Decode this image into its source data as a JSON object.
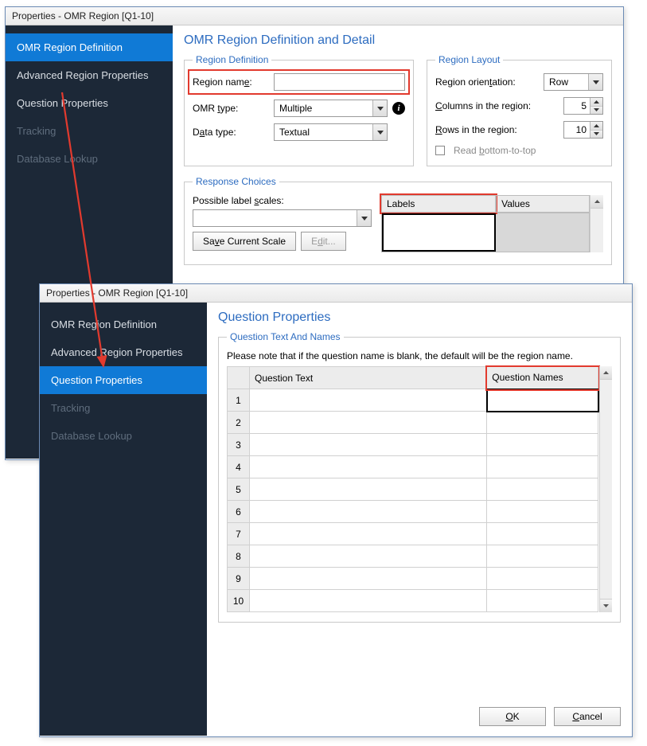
{
  "windows": {
    "title": "Properties - OMR Region [Q1-10]"
  },
  "sidebar": {
    "items": [
      {
        "label": "OMR Region Definition"
      },
      {
        "label": "Advanced Region Properties"
      },
      {
        "label": "Question Properties"
      },
      {
        "label": "Tracking"
      },
      {
        "label": "Database Lookup"
      }
    ]
  },
  "page1": {
    "title": "OMR Region Definition and Detail",
    "groupDef": {
      "legend": "Region Definition",
      "regionNameLabelPre": "Region nam",
      "regionNameLabelU": "e",
      "regionNameLabelPost": ":",
      "regionNameValue": "",
      "omrTypeLabelPre": "OMR ",
      "omrTypeLabelU": "t",
      "omrTypeLabelPost": "ype:",
      "omrTypeValue": "Multiple",
      "dataTypeLabelPre": "D",
      "dataTypeLabelU": "a",
      "dataTypeLabelPost": "ta type:",
      "dataTypeValue": "Textual"
    },
    "groupLayout": {
      "legend": "Region Layout",
      "orientationLabelPre": "Region orien",
      "orientationLabelU": "t",
      "orientationLabelPost": "ation:",
      "orientationValue": "Row",
      "colsLabelPre": "",
      "colsLabelU": "C",
      "colsLabelPost": "olumns in the region:",
      "colsValue": "5",
      "rowsLabelPre": "",
      "rowsLabelU": "R",
      "rowsLabelPost": "ows in the region:",
      "rowsValue": "10",
      "readLabelPre": "Read ",
      "readLabelU": "b",
      "readLabelPost": "ottom-to-top"
    },
    "groupResp": {
      "legend": "Response Choices",
      "possLabelPre": "Possible label ",
      "possLabelU": "s",
      "possLabelPost": "cales:",
      "saveBtnPre": "Sa",
      "saveBtnU": "v",
      "saveBtnPost": "e Current Scale",
      "editBtnPre": "E",
      "editBtnU": "d",
      "editBtnPost": "it...",
      "colLabels": "Labels",
      "colValues": "Values"
    }
  },
  "page2": {
    "title": "Question Properties",
    "group": {
      "legend": "Question Text And Names",
      "note": "Please note that if the question name is blank, the default will be the region name.",
      "colText": "Question Text",
      "colNames": "Question Names",
      "rows": [
        "1",
        "2",
        "3",
        "4",
        "5",
        "6",
        "7",
        "8",
        "9",
        "10"
      ]
    },
    "buttons": {
      "okPre": "",
      "okU": "O",
      "okPost": "K",
      "cancelPre": "",
      "cancelU": "C",
      "cancelPost": "ancel"
    }
  }
}
